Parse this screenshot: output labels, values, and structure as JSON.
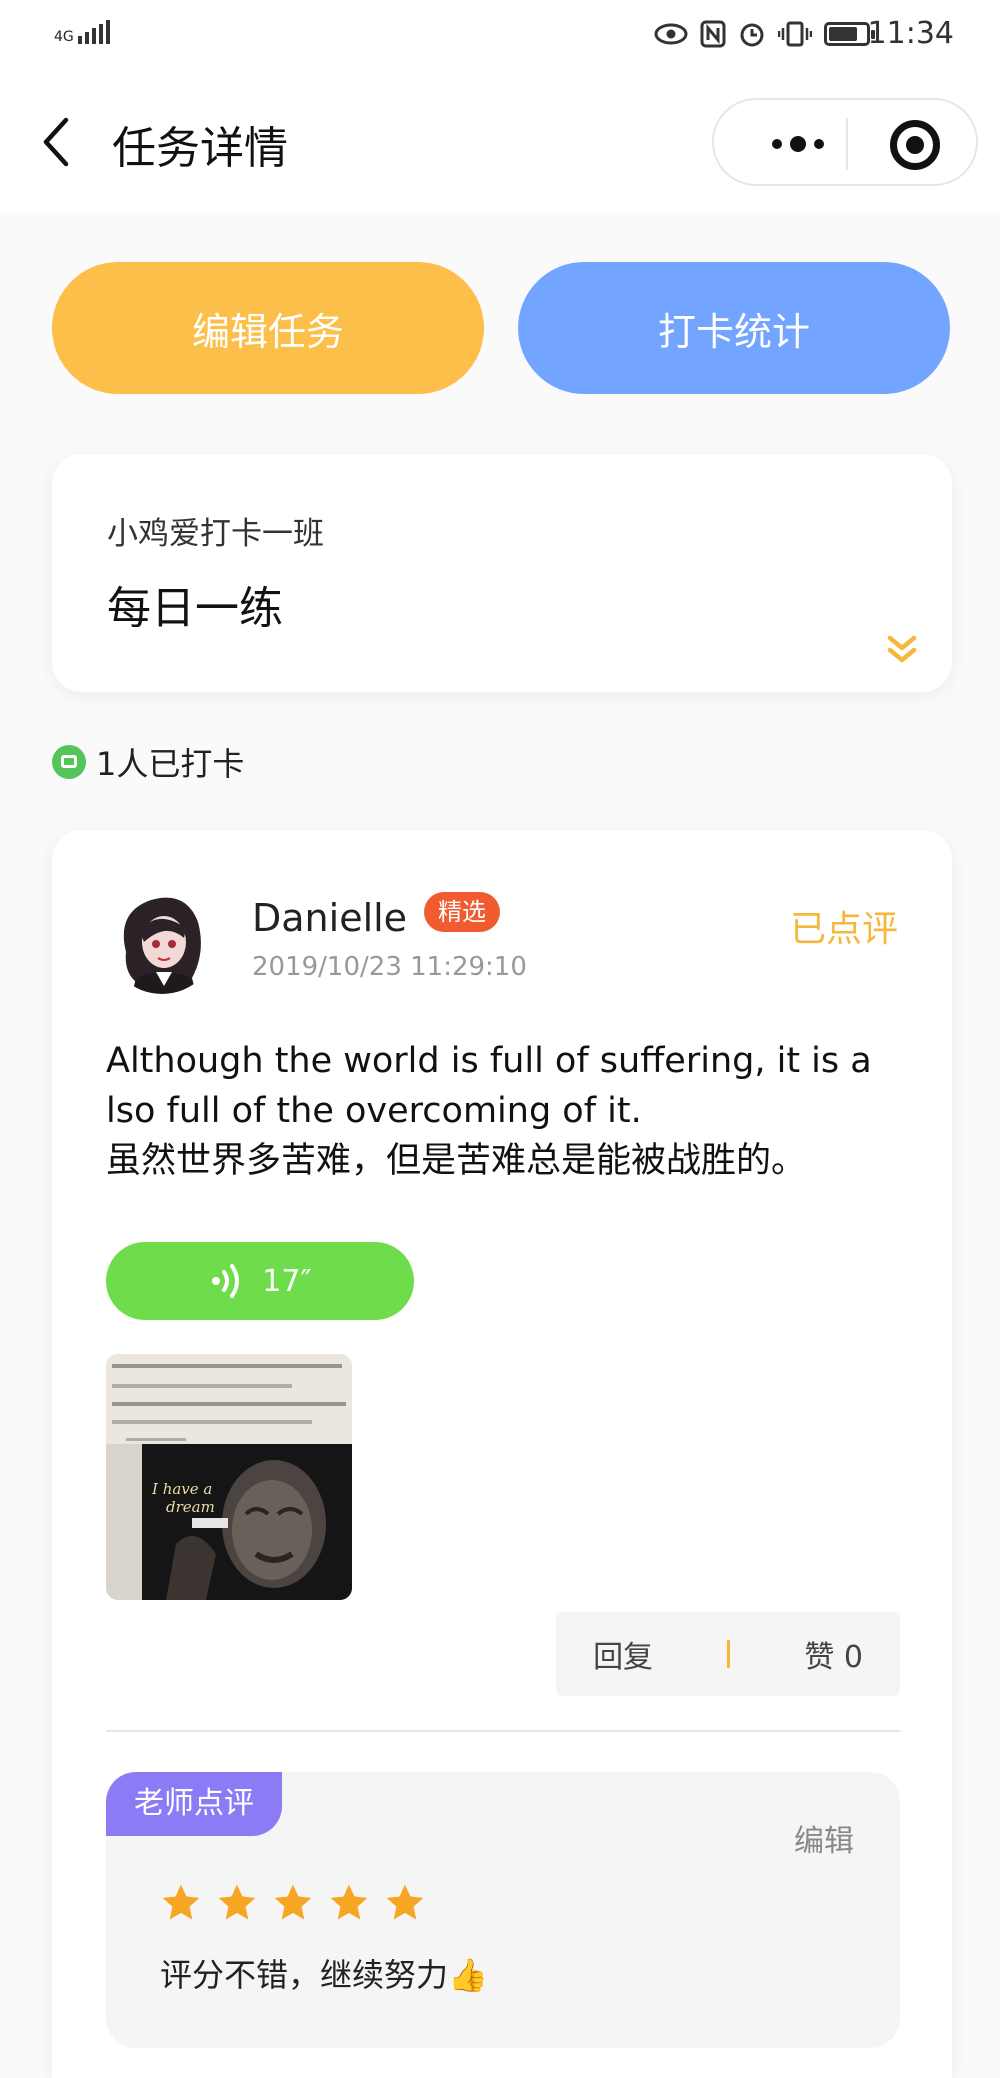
{
  "status_bar": {
    "network": "4G",
    "time": "11:34"
  },
  "nav": {
    "title": "任务详情"
  },
  "buttons": {
    "edit_task": "编辑任务",
    "checkin_stats": "打卡统计"
  },
  "task": {
    "class_name": "小鸡爱打卡一班",
    "task_name": "每日一练"
  },
  "checkin_summary": "1人已打卡",
  "post": {
    "user_name": "Danielle",
    "badge": "精选",
    "timestamp": "2019/10/23 11:29:10",
    "review_status": "已点评",
    "content": "Although the world is full of suffering, it is a\nlso full of the overcoming of it.\n虽然世界多苦难，但是苦难总是能被战胜的。",
    "audio_duration": "17″",
    "image_text": {
      "headline": "I have a",
      "headline2": "dream"
    },
    "reply_label": "回复",
    "like_label": "赞 0"
  },
  "teacher_review": {
    "tag": "老师点评",
    "edit_label": "编辑",
    "rating": 5,
    "rating_max": 5,
    "comment": "评分不错，继续努力👍"
  },
  "colors": {
    "edit_button": "#fcbf49",
    "stats_button": "#73a4ff",
    "audio_button": "#6fdc4c",
    "featured_badge": "#f05b2f",
    "reviewed_text": "#f6b73c",
    "review_tag": "#8b7cf6",
    "star": "#f7a623"
  }
}
